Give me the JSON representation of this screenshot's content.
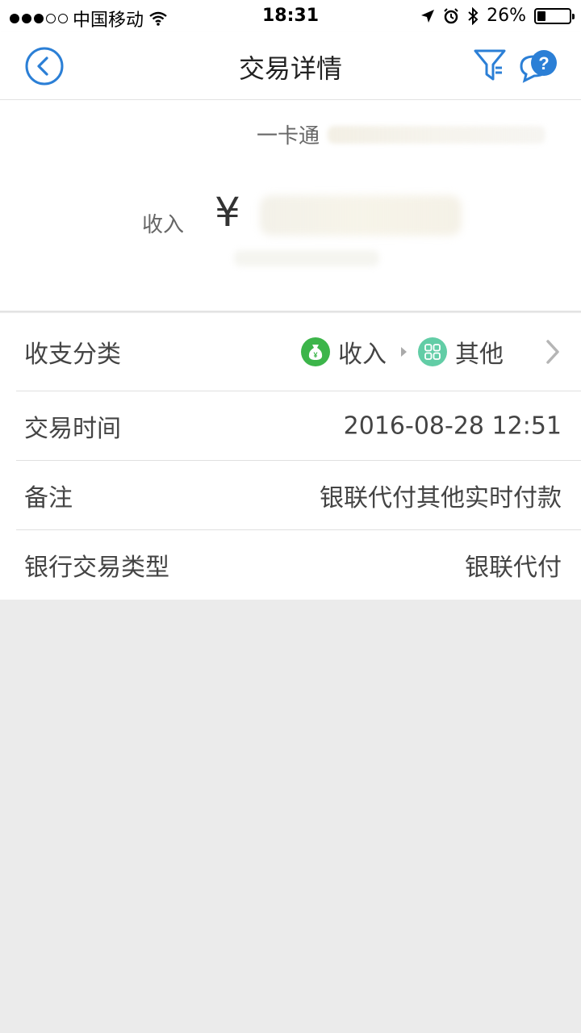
{
  "status_bar": {
    "carrier": "中国移动",
    "time": "18:31",
    "battery": "26%",
    "battery_level": 0.26
  },
  "nav": {
    "title": "交易详情",
    "icons": [
      "back-icon",
      "filter-icon",
      "help-chat-icon"
    ]
  },
  "summary": {
    "account_prefix": "一卡通",
    "amount_label": "收入",
    "currency_symbol": "¥"
  },
  "details": {
    "category": {
      "label": "收支分类",
      "primary": "收入",
      "secondary": "其他"
    },
    "time": {
      "label": "交易时间",
      "value": "2016-08-28 12:51"
    },
    "note": {
      "label": "备注",
      "value": "银联代付其他实时付款"
    },
    "bank_type": {
      "label": "银行交易类型",
      "value": "银联代付"
    }
  },
  "colors": {
    "accent": "#2b7fd6",
    "income_green": "#3cb54a",
    "other_teal": "#62cda6",
    "background": "#ebebeb"
  }
}
